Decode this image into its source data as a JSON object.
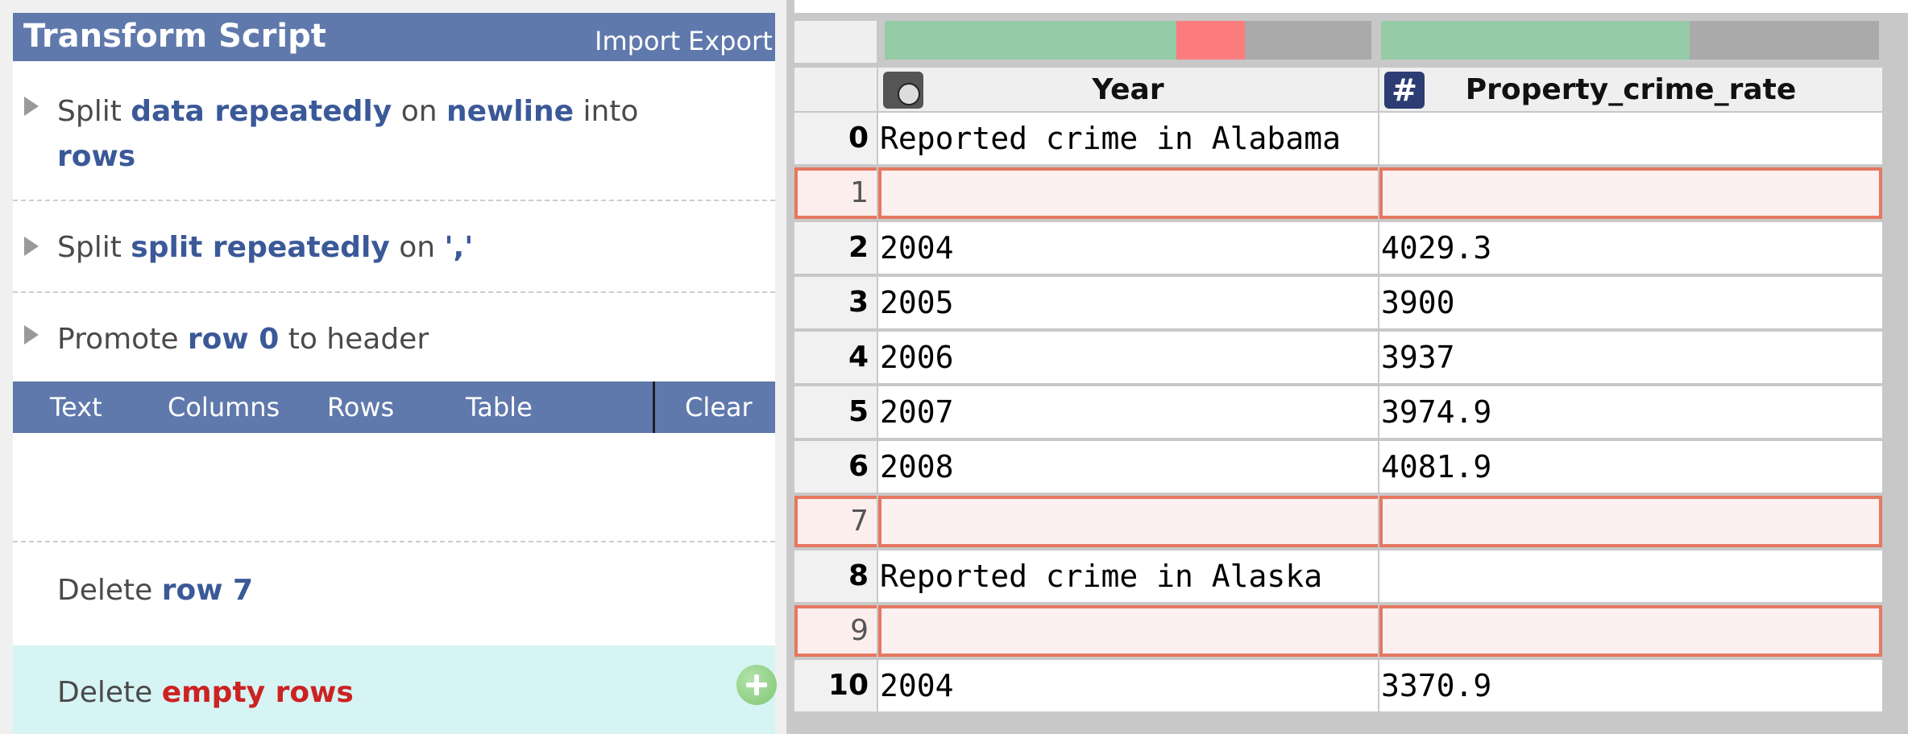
{
  "script_panel": {
    "title": "Transform Script",
    "import_label": "Import",
    "export_label": "Export",
    "steps": [
      {
        "verb": "Split",
        "p1": "data repeatedly",
        "w1": "on",
        "p2": "newline",
        "w2": "into",
        "p3": "rows"
      },
      {
        "verb": "Split",
        "p1": "split repeatedly",
        "w1": "on",
        "p2": "','"
      },
      {
        "verb": "Promote",
        "p1": "row 0",
        "w1": "to header"
      }
    ],
    "menu": [
      "Text",
      "Columns",
      "Rows",
      "Table",
      "Clear"
    ],
    "suggestions": [
      {
        "verb": "Delete",
        "param": "row 7"
      },
      {
        "verb": "Delete",
        "param": "empty rows"
      }
    ]
  },
  "colors": {
    "header_blue": "#6079ac",
    "keyword_blue": "#3b5998",
    "keyword_red": "#cc2222",
    "valid_green": "#95cca7",
    "missing_red": "#fc7c7e",
    "selected_row_border": "#e57860",
    "suggestion_bg": "#d7f4f4"
  },
  "table": {
    "columns": [
      {
        "name": "Year",
        "type_icon": "clock-icon",
        "quality": {
          "valid": 0.6,
          "missing": 0.14
        }
      },
      {
        "name": "Property_crime_rate",
        "type_icon": "hash-icon",
        "quality": {
          "valid": 0.62,
          "missing": 0
        }
      }
    ],
    "rows": [
      {
        "idx": "0",
        "year": "Reported crime in Alabama",
        "rate": ""
      },
      {
        "idx": "1",
        "year": "",
        "rate": "",
        "highlight": true
      },
      {
        "idx": "2",
        "year": "2004",
        "rate": "4029.3"
      },
      {
        "idx": "3",
        "year": "2005",
        "rate": "3900"
      },
      {
        "idx": "4",
        "year": "2006",
        "rate": "3937"
      },
      {
        "idx": "5",
        "year": "2007",
        "rate": "3974.9"
      },
      {
        "idx": "6",
        "year": "2008",
        "rate": "4081.9"
      },
      {
        "idx": "7",
        "year": "",
        "rate": "",
        "highlight": true
      },
      {
        "idx": "8",
        "year": "Reported crime in Alaska",
        "rate": ""
      },
      {
        "idx": "9",
        "year": "",
        "rate": "",
        "highlight": true
      },
      {
        "idx": "10",
        "year": "2004",
        "rate": "3370.9"
      }
    ]
  }
}
